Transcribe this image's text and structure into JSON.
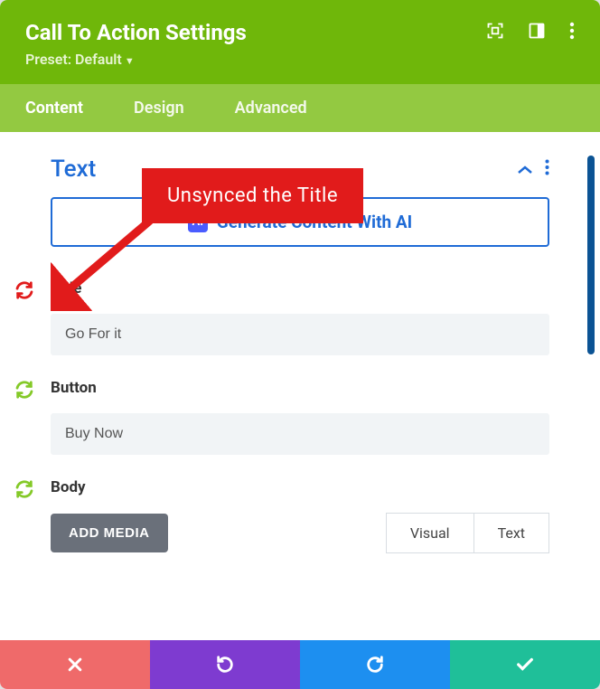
{
  "header": {
    "title": "Call To Action Settings",
    "preset_label": "Preset: Default"
  },
  "tabs": {
    "content": "Content",
    "design": "Design",
    "advanced": "Advanced"
  },
  "section": {
    "title": "Text"
  },
  "ai_button": {
    "label": "Generate Content With AI",
    "icon_text": "AI"
  },
  "fields": {
    "title": {
      "label": "Title",
      "value": "Go For it"
    },
    "button": {
      "label": "Button",
      "value": "Buy Now"
    },
    "body": {
      "label": "Body",
      "add_media": "ADD MEDIA"
    }
  },
  "editor_tabs": {
    "visual": "Visual",
    "text": "Text"
  },
  "annotation": {
    "text": "Unsynced  the Title"
  },
  "colors": {
    "unsynced": "#e11b1b",
    "synced": "#84c928"
  }
}
